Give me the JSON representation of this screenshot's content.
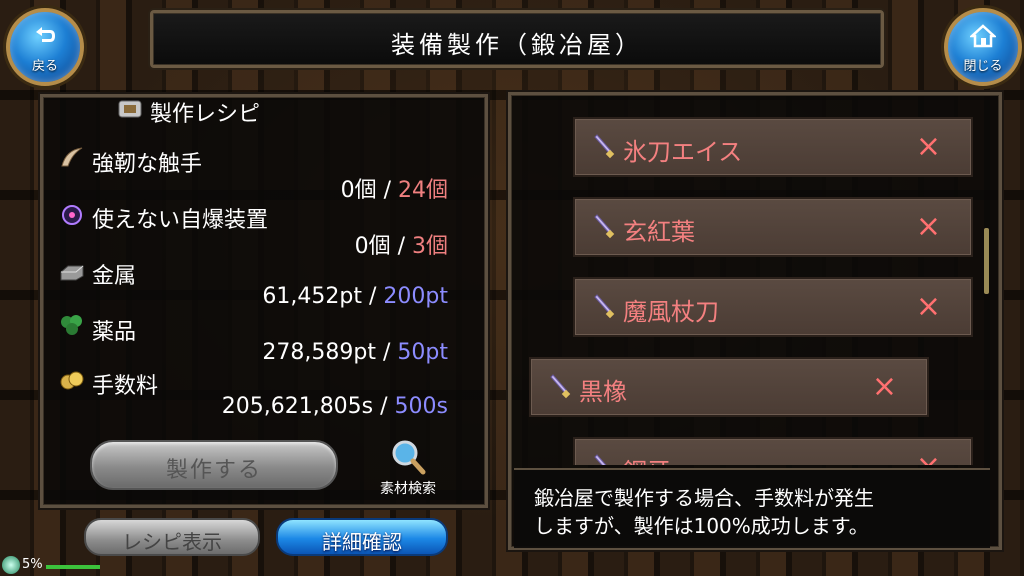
{
  "header": {
    "title": "装備製作（鍛冶屋）",
    "back_label": "戻る",
    "close_label": "閉じる"
  },
  "recipe": {
    "heading": "製作レシピ",
    "materials": [
      {
        "name": "強靭な触手",
        "have": "0個",
        "sep": " / ",
        "need": "24個",
        "icon": "tentacle-icon"
      },
      {
        "name": "使えない自爆装置",
        "have": "0個",
        "sep": " / ",
        "need": "3個",
        "icon": "orb-device-icon"
      }
    ],
    "resources": [
      {
        "name": "金属",
        "have": "61,452pt",
        "sep": " / ",
        "need": "200pt",
        "icon": "metal-icon"
      },
      {
        "name": "薬品",
        "have": "278,589pt",
        "sep": " / ",
        "need": "50pt",
        "icon": "herb-icon"
      },
      {
        "name": "手数料",
        "have": "205,621,805s",
        "sep": " / ",
        "need": "500s",
        "icon": "coins-icon"
      }
    ],
    "make_label": "製作する",
    "search_label": "素材検索"
  },
  "footer_buttons": {
    "recipe_view": "レシピ表示",
    "detail_confirm": "詳細確認"
  },
  "equipment_list": [
    {
      "name": "氷刀エイス",
      "mark": "×"
    },
    {
      "name": "玄紅葉",
      "mark": "×"
    },
    {
      "name": "魔風杖刀",
      "mark": "×"
    },
    {
      "name": "黒橡",
      "mark": "×"
    },
    {
      "name": "鋼牙",
      "mark": "×"
    }
  ],
  "info": {
    "line1": "鍛冶屋で製作する場合、手数料が発生",
    "line2": "しますが、製作は100%成功します。"
  },
  "status": {
    "percent": "5%"
  },
  "colors": {
    "requirement_red": "#f08080",
    "requirement_blue": "#8c8cff",
    "item_name": "#f48080"
  }
}
